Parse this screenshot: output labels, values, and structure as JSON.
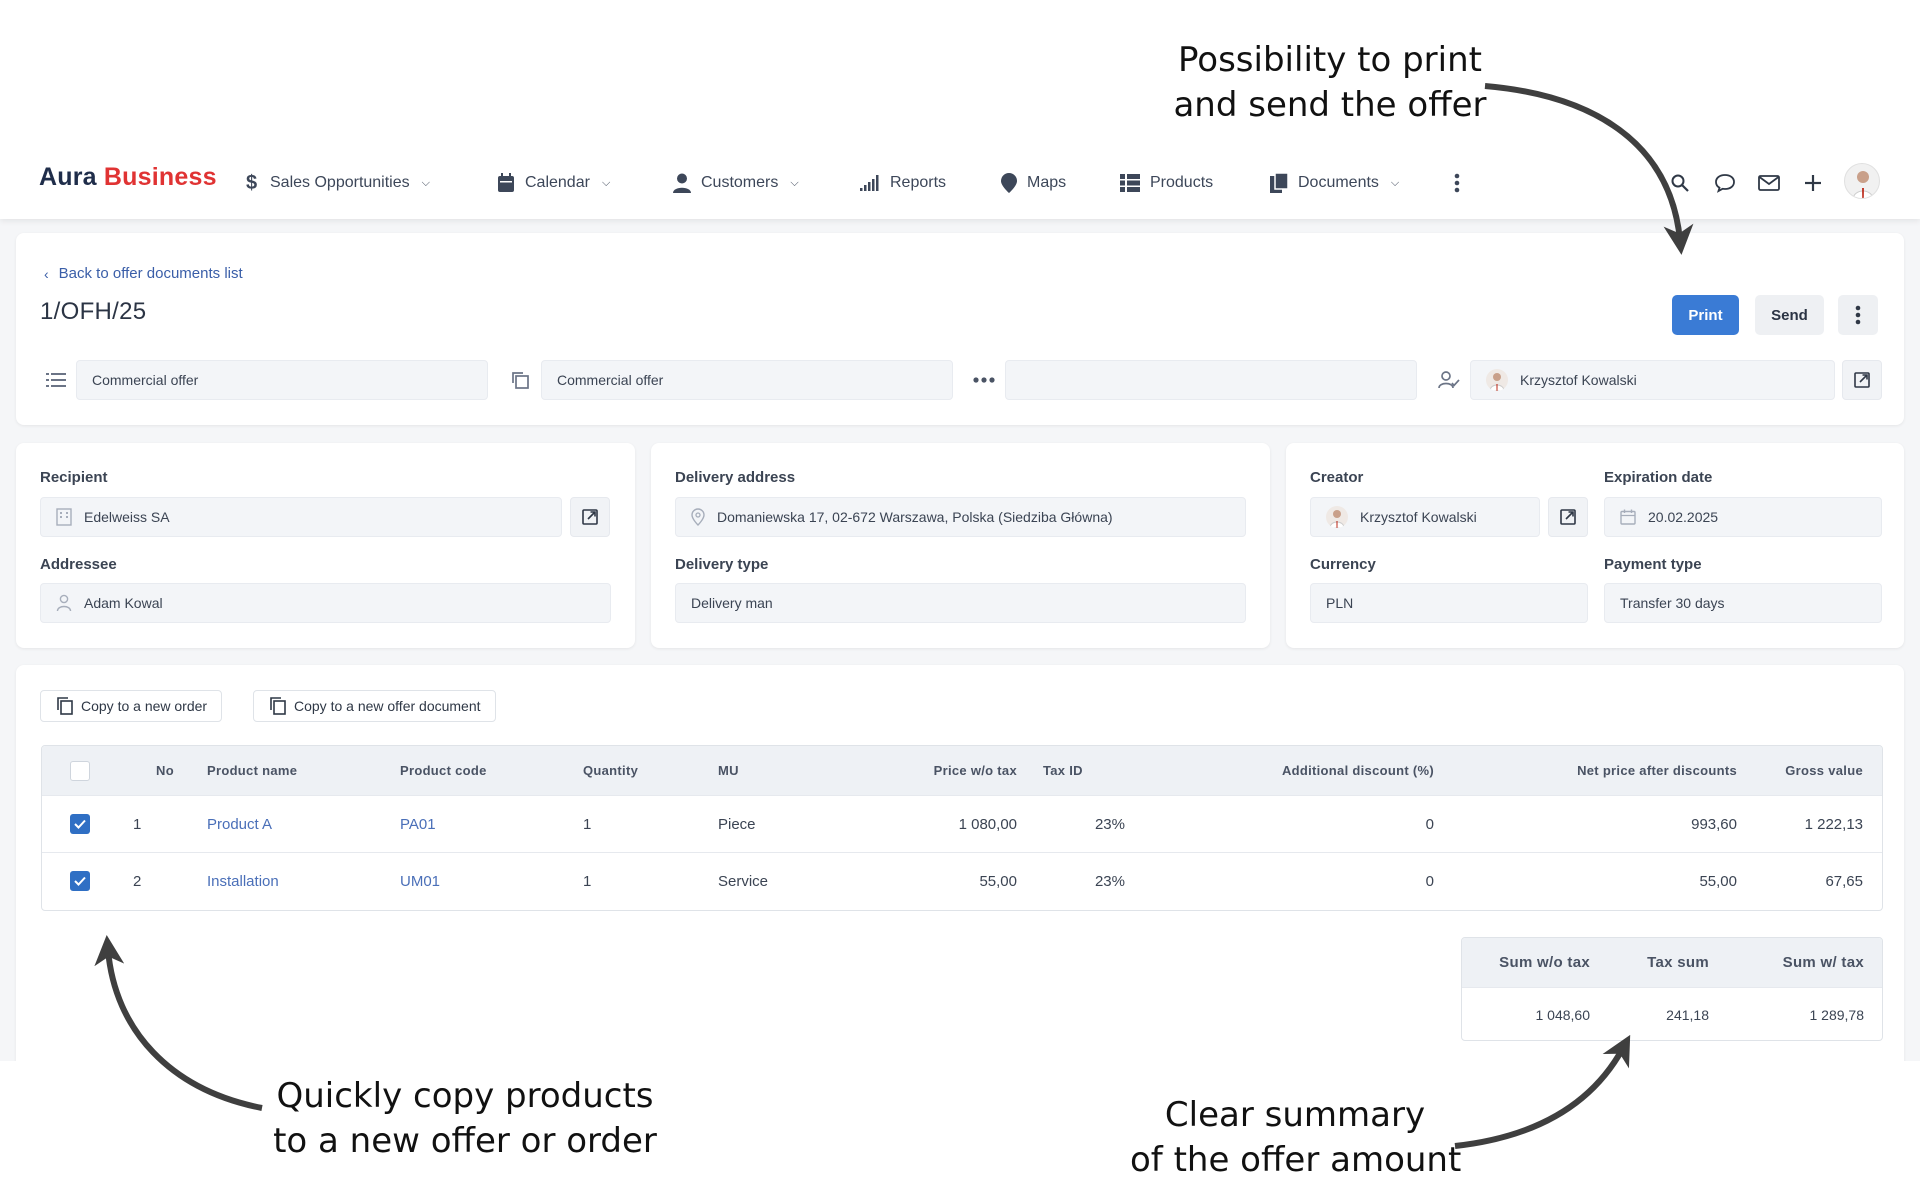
{
  "annotations": {
    "print_line1": "Possibility to print",
    "print_line2": "and send the offer",
    "copy_line1": "Quickly copy products",
    "copy_line2": "to a new offer or order",
    "summary_line1": "Clear summary",
    "summary_line2": "of the offer amount"
  },
  "navbar": {
    "logo_part1": "Aura",
    "logo_part2": "Business",
    "items": [
      {
        "label": "Sales Opportunities",
        "icon": "dollar-icon",
        "dropdown": true
      },
      {
        "label": "Calendar",
        "icon": "calendar-icon",
        "dropdown": true
      },
      {
        "label": "Customers",
        "icon": "person-icon",
        "dropdown": true
      },
      {
        "label": "Reports",
        "icon": "bar-chart-icon",
        "dropdown": false
      },
      {
        "label": "Maps",
        "icon": "map-pin-icon",
        "dropdown": false
      },
      {
        "label": "Products",
        "icon": "list-grid-icon",
        "dropdown": false
      },
      {
        "label": "Documents",
        "icon": "documents-icon",
        "dropdown": true
      }
    ],
    "right_icons": [
      "search-icon",
      "chat-icon",
      "mail-icon",
      "plus-icon",
      "user-avatar"
    ]
  },
  "header": {
    "back_link": "Back to offer documents list",
    "doc_number": "1/OFH/25",
    "print_label": "Print",
    "send_label": "Send",
    "doc_type_1": "Commercial offer",
    "doc_type_2": "Commercial offer",
    "extra_field": "",
    "owner": "Krzysztof Kowalski"
  },
  "recipient": {
    "recipient_label": "Recipient",
    "recipient_value": "Edelweiss SA",
    "addressee_label": "Addressee",
    "addressee_value": "Adam Kowal"
  },
  "delivery": {
    "address_label": "Delivery address",
    "address_value": "Domaniewska 17, 02-672 Warszawa, Polska (Siedziba Główna)",
    "type_label": "Delivery type",
    "type_value": "Delivery man"
  },
  "details": {
    "creator_label": "Creator",
    "creator_value": "Krzysztof Kowalski",
    "expiration_label": "Expiration date",
    "expiration_value": "20.02.2025",
    "currency_label": "Currency",
    "currency_value": "PLN",
    "payment_label": "Payment type",
    "payment_value": "Transfer 30 days"
  },
  "products": {
    "copy_order_label": "Copy to a new order",
    "copy_offer_label": "Copy to a new offer document",
    "columns": {
      "no": "No",
      "name": "Product name",
      "code": "Product code",
      "qty": "Quantity",
      "mu": "MU",
      "price": "Price w/o tax",
      "tax": "Tax ID",
      "discount": "Additional discount (%)",
      "net": "Net price after discounts",
      "gross": "Gross value"
    },
    "rows": [
      {
        "checked": true,
        "no": "1",
        "name": "Product A",
        "code": "PA01",
        "qty": "1",
        "mu": "Piece",
        "price": "1 080,00",
        "tax": "23%",
        "discount": "0",
        "net": "993,60",
        "gross": "1 222,13"
      },
      {
        "checked": true,
        "no": "2",
        "name": "Installation",
        "code": "UM01",
        "qty": "1",
        "mu": "Service",
        "price": "55,00",
        "tax": "23%",
        "discount": "0",
        "net": "55,00",
        "gross": "67,65"
      }
    ]
  },
  "summary": {
    "sum_wo_tax_label": "Sum w/o tax",
    "tax_sum_label": "Tax sum",
    "sum_w_tax_label": "Sum w/ tax",
    "sum_wo_tax": "1 048,60",
    "tax_sum": "241,18",
    "sum_w_tax": "1 289,78"
  },
  "colors": {
    "accent": "#3a7bd5",
    "logo_dark": "#1f2d4a",
    "logo_red": "#e03333",
    "link": "#4a6fb8"
  }
}
